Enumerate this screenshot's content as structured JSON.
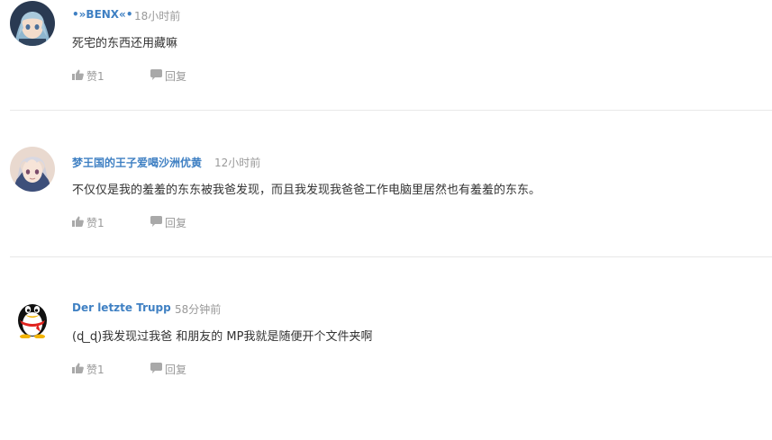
{
  "comments": [
    {
      "username": "•»BENX«•",
      "time": "18小时前",
      "content": "死宅的东西还用藏嘛",
      "like_label": "赞1",
      "reply_label": "回复"
    },
    {
      "username": "梦王国的王子爱喝沙洲优黄",
      "time": "12小时前",
      "content": "不仅仅是我的羞羞的东东被我爸发现，而且我发现我爸爸工作电脑里居然也有羞羞的东东。",
      "like_label": "赞1",
      "reply_label": "回复"
    },
    {
      "username": "Der letzte Trupp",
      "time": "58分钟前",
      "content": "(ɖ_ɖ)我发现过我爸 和朋友的 MP我就是随便开个文件夹啊",
      "like_label": "赞1",
      "reply_label": "回复"
    }
  ],
  "colors": {
    "username": "#3f80c3",
    "meta": "#999999",
    "text": "#333333",
    "divider": "#e8e8e8"
  },
  "icons": {
    "like": "thumbs-up-icon",
    "reply": "speech-bubble-icon"
  }
}
